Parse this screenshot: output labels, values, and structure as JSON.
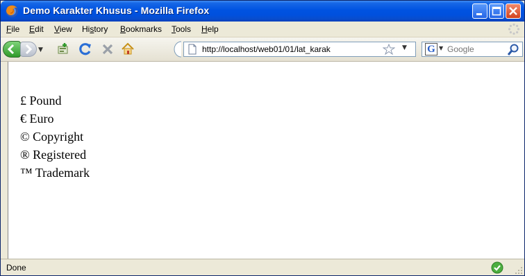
{
  "window": {
    "title": "Demo Karakter Khusus - Mozilla Firefox"
  },
  "menu": [
    {
      "label": "File",
      "accel": "F",
      "rest": "ile"
    },
    {
      "label": "Edit",
      "accel": "E",
      "rest": "dit"
    },
    {
      "label": "View",
      "accel": "V",
      "rest": "iew"
    },
    {
      "label": "History",
      "accel": "s",
      "pre": "Hi",
      "rest": "tory"
    },
    {
      "label": "Bookmarks",
      "accel": "B",
      "rest": "ookmarks"
    },
    {
      "label": "Tools",
      "accel": "T",
      "rest": "ools"
    },
    {
      "label": "Help",
      "accel": "H",
      "rest": "elp"
    }
  ],
  "toolbar": {
    "url": "http://localhost/web01/01/lat_karak",
    "search_placeholder": "Google"
  },
  "content": {
    "lines": [
      "£ Pound",
      "€ Euro",
      "© Copyright",
      "® Registered",
      "™ Trademark"
    ]
  },
  "status": {
    "text": "Done"
  },
  "colors": {
    "titlebar": "#0053e1",
    "close_button": "#d2431e",
    "chrome": "#ece9d8"
  },
  "icons": [
    "firefox-icon",
    "minimize-icon",
    "maximize-icon",
    "close-icon",
    "back-icon",
    "forward-icon",
    "add-bookmark-icon",
    "reload-icon",
    "stop-icon",
    "home-icon",
    "page-icon",
    "star-icon",
    "google-icon",
    "search-icon",
    "status-ok-icon"
  ]
}
